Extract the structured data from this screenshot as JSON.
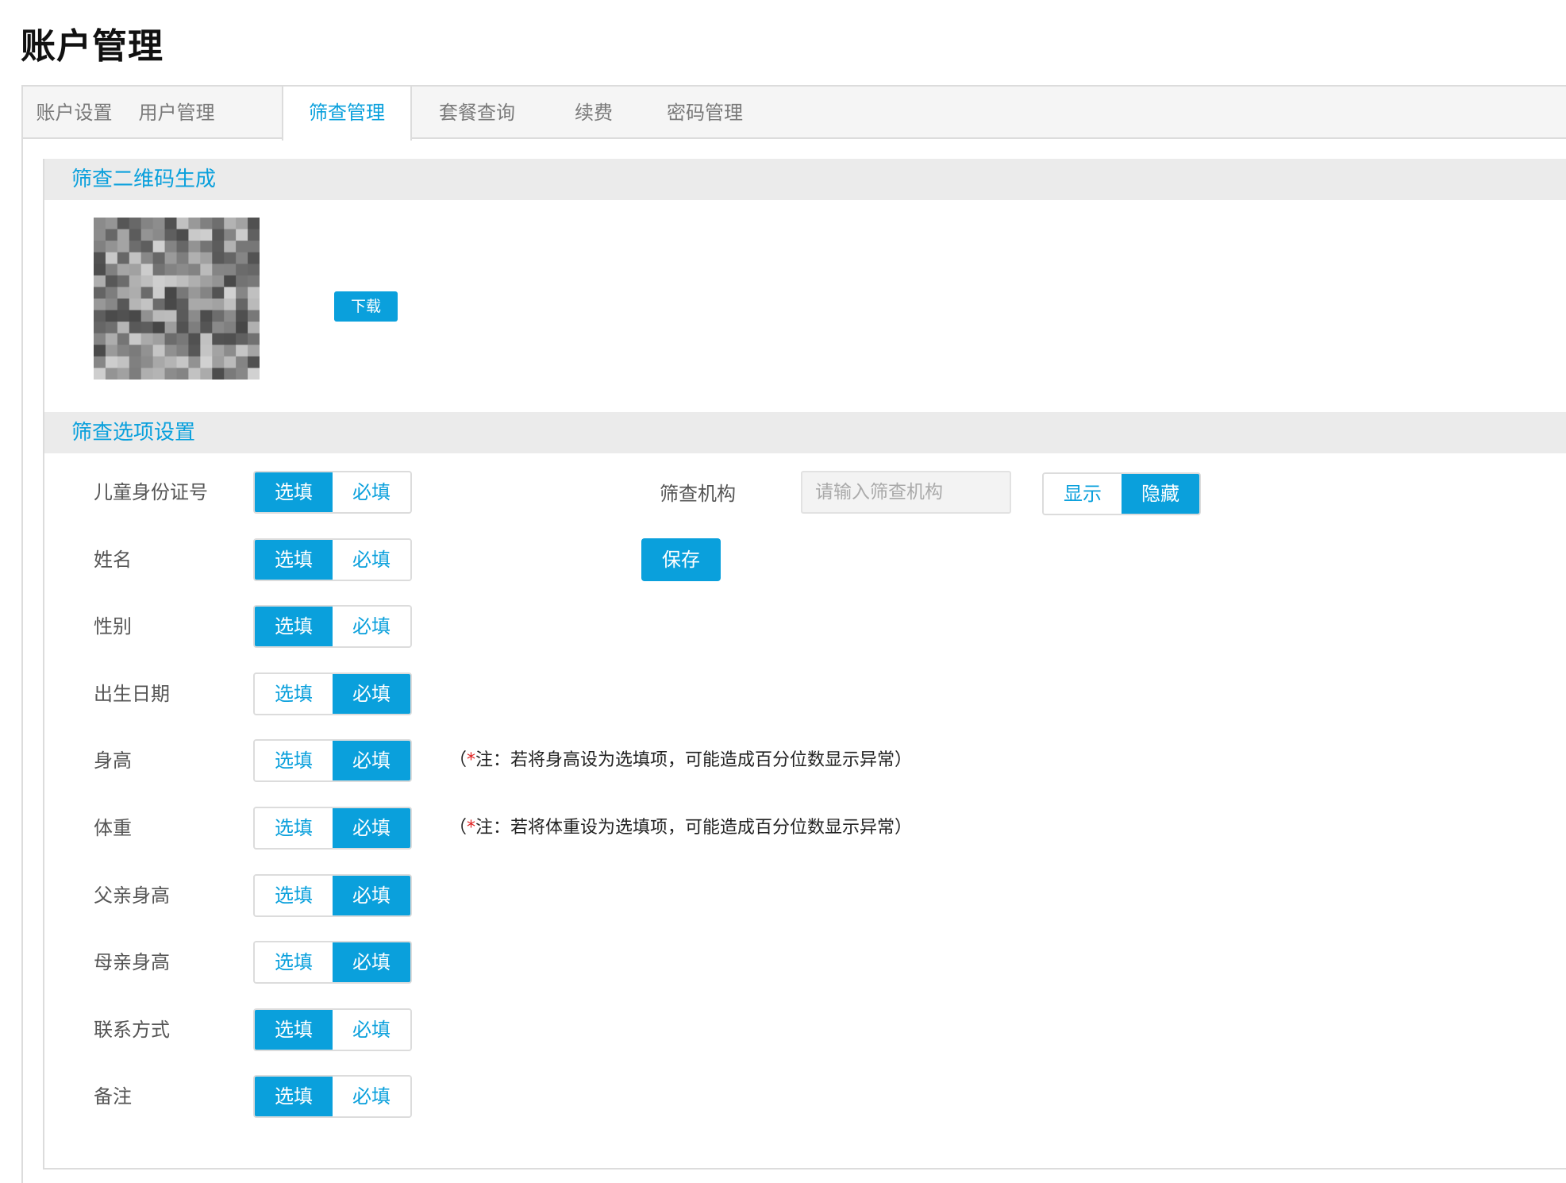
{
  "page_title": "账户管理",
  "tabs": [
    {
      "label": "账户设置",
      "active": false
    },
    {
      "label": "用户管理",
      "active": false
    },
    {
      "label": "筛查管理",
      "active": true
    },
    {
      "label": "套餐查询",
      "active": false
    },
    {
      "label": "续费",
      "active": false
    },
    {
      "label": "密码管理",
      "active": false
    }
  ],
  "qr_section": {
    "title": "筛查二维码生成",
    "download_label": "下载"
  },
  "options_section": {
    "title": "筛查选项设置",
    "option_labels": {
      "optional": "选填",
      "required": "必填"
    },
    "rows": [
      {
        "label": "儿童身份证号",
        "selected": "optional"
      },
      {
        "label": "姓名",
        "selected": "optional"
      },
      {
        "label": "性别",
        "selected": "optional"
      },
      {
        "label": "出生日期",
        "selected": "required"
      },
      {
        "label": "身高",
        "selected": "required",
        "note_prefix": "（",
        "note_star": "*",
        "note_text": "注：若将身高设为选填项，可能造成百分位数显示异常）"
      },
      {
        "label": "体重",
        "selected": "required",
        "note_prefix": "（",
        "note_star": "*",
        "note_text": "注：若将体重设为选填项，可能造成百分位数显示异常）"
      },
      {
        "label": "父亲身高",
        "selected": "required"
      },
      {
        "label": "母亲身高",
        "selected": "required"
      },
      {
        "label": "联系方式",
        "selected": "optional"
      },
      {
        "label": "备注",
        "selected": "optional"
      }
    ],
    "institution": {
      "label": "筛查机构",
      "placeholder": "请输入筛查机构",
      "value": "",
      "show_label": "显示",
      "hide_label": "隐藏",
      "selected": "hide"
    },
    "save_label": "保存"
  },
  "colors": {
    "accent": "#0aa0dc",
    "section_bg": "#ebebeb",
    "note_star": "#e02020"
  }
}
